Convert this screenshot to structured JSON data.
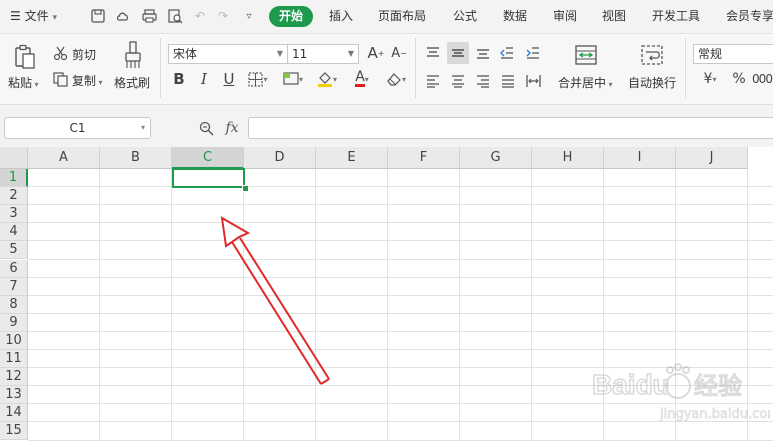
{
  "menubar": {
    "file_label": "文件",
    "tabs": [
      "开始",
      "插入",
      "页面布局",
      "公式",
      "数据",
      "审阅",
      "视图",
      "开发工具",
      "会员专享"
    ],
    "active_tab": "开始",
    "active_color": "#1d9a4c"
  },
  "ribbon": {
    "paste_label": "粘贴",
    "cut_label": "剪切",
    "copy_label": "复制",
    "format_painter_label": "格式刷",
    "font_name": "宋体",
    "font_size": "11",
    "bold": "B",
    "italic": "I",
    "underline": "U",
    "font_color_glyph": "A",
    "merge_center_label": "合并居中",
    "wrap_text_label": "自动换行",
    "number_format": "常规",
    "currency_glyph": "¥",
    "percent_glyph": "%"
  },
  "formula_bar": {
    "cell_ref": "C1",
    "fx": "fx",
    "content": ""
  },
  "sheet": {
    "columns": [
      "A",
      "B",
      "C",
      "D",
      "E",
      "F",
      "G",
      "H",
      "I",
      "J"
    ],
    "rows": [
      "1",
      "2",
      "3",
      "4",
      "5",
      "6",
      "7",
      "8",
      "9",
      "10",
      "11",
      "12",
      "13",
      "14",
      "15"
    ],
    "selected_column": "C",
    "selected_row": "1"
  },
  "watermark": {
    "brand": "Baidu",
    "sub": "经验",
    "url": "jingyan.baidu.com"
  }
}
